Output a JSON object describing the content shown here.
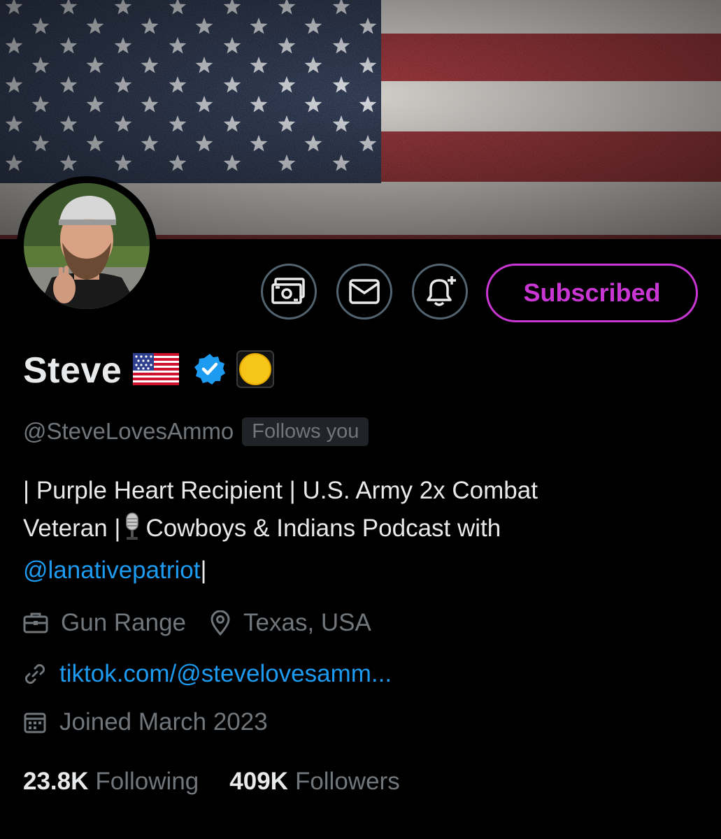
{
  "profile": {
    "name": "Steve",
    "handle": "@SteveLovesAmmo",
    "follows_you": "Follows you",
    "bio_line1": "| Purple Heart Recipient | U.S. Army 2x Combat",
    "bio_line2_a": "Veteran |",
    "bio_line2_b": "Cowboys & Indians Podcast with",
    "bio_mention": "@lanativepatriot",
    "bio_end": "|",
    "category": "Gun Range",
    "location": "Texas, USA",
    "website": "tiktok.com/@stevelovesamm...",
    "joined": "Joined March 2023"
  },
  "actions": {
    "subscribe_label": "Subscribed"
  },
  "icons": {
    "tip": "money-icon",
    "message": "envelope-icon",
    "notify": "bell-plus-icon",
    "verified": "verified-badge-icon",
    "category": "briefcase-icon",
    "location": "location-pin-icon",
    "link": "link-icon",
    "calendar": "calendar-icon"
  },
  "stats": {
    "following_count": "23.8K",
    "following_label": "Following",
    "followers_count": "409K",
    "followers_label": "Followers"
  },
  "colors": {
    "background": "#000000",
    "text": "#e7e9ea",
    "muted": "#71767b",
    "link": "#1d9bf0",
    "subscribe": "#c936d3",
    "border": "#536471"
  }
}
